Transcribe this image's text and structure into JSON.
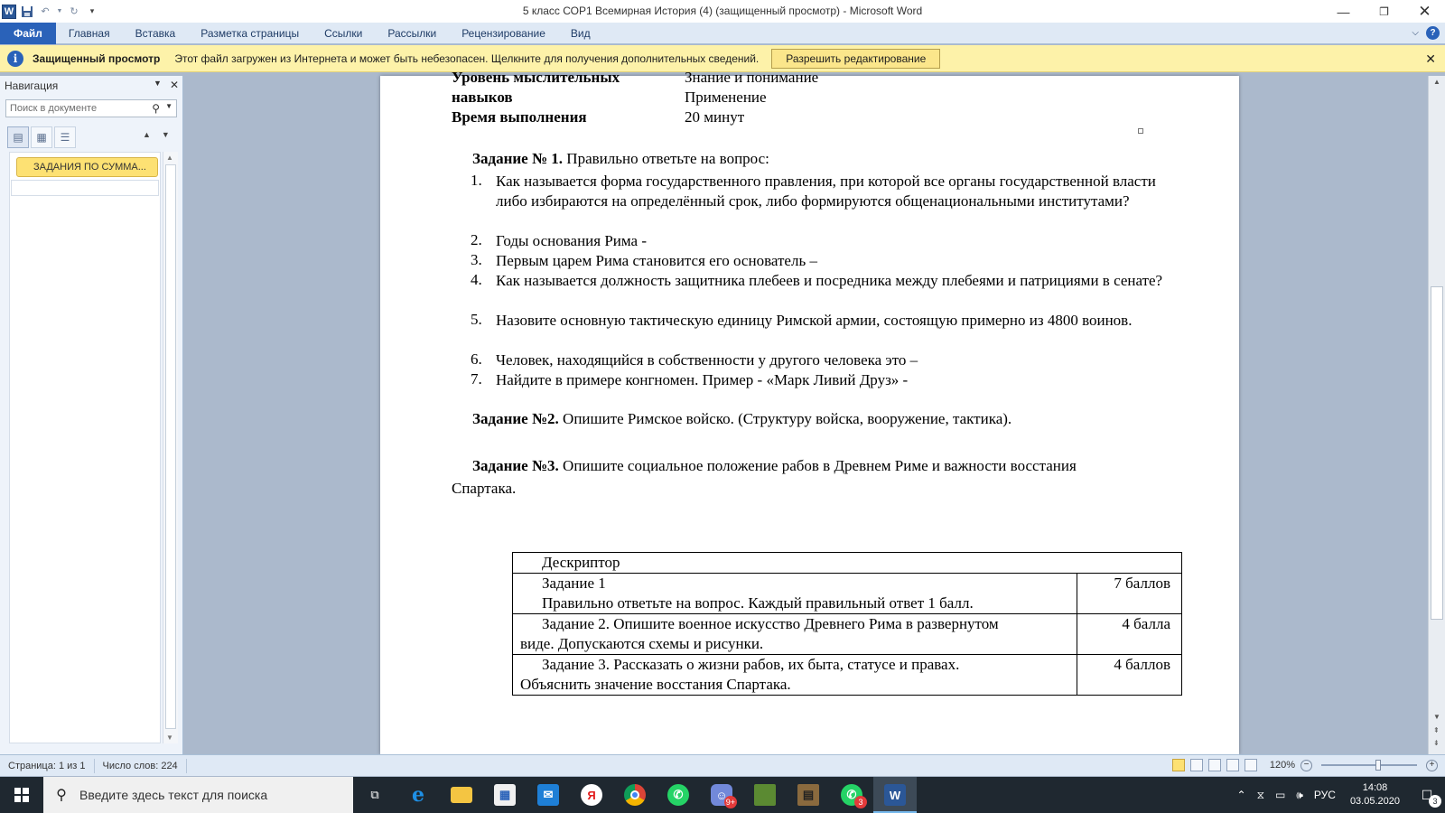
{
  "window": {
    "title": "5 класс СОР1 Всемирная История (4) (защищенный просмотр)  -  Microsoft Word",
    "logo_letter": "W"
  },
  "ribbon": {
    "tabs": [
      "Файл",
      "Главная",
      "Вставка",
      "Разметка страницы",
      "Ссылки",
      "Рассылки",
      "Рецензирование",
      "Вид"
    ]
  },
  "protected_bar": {
    "title": "Защищенный просмотр",
    "message": "Этот файл загружен из Интернета и может быть небезопасен. Щелкните для получения дополнительных сведений.",
    "button": "Разрешить редактирование"
  },
  "navigation": {
    "title": "Навигация",
    "search_placeholder": "Поиск в документе",
    "heading_item": "ЗАДАНИЯ ПО СУММА..."
  },
  "document": {
    "skill_label_1": "Уровень мыслительных",
    "skill_label_2": "навыков",
    "skill_value_1": "Знание и понимание",
    "skill_value_2": "Применение",
    "time_label": "Время выполнения",
    "time_value": "20 минут",
    "task1": {
      "label": "Задание № 1.",
      "text": " Правильно ответьте на вопрос:",
      "questions": [
        {
          "num": "1.",
          "text": "Как называется форма государственного правления, при которой все органы государственной власти либо избираются на определённый срок, либо формируются общенациональными институтами?"
        },
        {
          "num": "2.",
          "text": "Годы основания Рима  -"
        },
        {
          "num": "3.",
          "text": "Первым царем Рима становится его основатель –"
        },
        {
          "num": "4.",
          "text": "Как называется должность  защитника плебеев и посредника между плебеями и патрициями  в сенате?"
        },
        {
          "num": "5.",
          "text": "Назовите основную тактическую  единицу Римской армии, состоящую примерно из 4800 воинов."
        },
        {
          "num": "6.",
          "text": "Человек, находящийся в собственности  у другого человека это –"
        },
        {
          "num": "7.",
          "text": "Найдите в примере конгномен. Пример -  «Марк Ливий Друз» -"
        }
      ]
    },
    "task2": {
      "label": "Задание №2.",
      "text": "  Опишите  Римское войско.  (Структуру войска, вооружение, тактика)."
    },
    "task3": {
      "label": "Задание №3.",
      "text": "  Опишите социальное положение рабов в Древнем Риме и важности восстания",
      "text_cont": "Спартака."
    },
    "table": {
      "header": "Дескриптор",
      "rows": [
        {
          "line1": "Задание 1",
          "line2": "Правильно ответьте на вопрос. Каждый правильный ответ 1 балл.",
          "points": "7 баллов"
        },
        {
          "line1": "Задание 2.   Опишите военное искусство Древнего Рима в развернутом",
          "line2": "виде. Допускаются  схемы и рисунки.",
          "points": "4 балла"
        },
        {
          "line1": "Задание 3.  Рассказать  о жизни рабов, их быта, статусе  и правах.",
          "line2": "Объяснить значение восстания Спартака.",
          "points": "4 баллов"
        }
      ]
    }
  },
  "statusbar": {
    "page": "Страница: 1 из 1",
    "words": "Число слов: 224",
    "zoom": "120%"
  },
  "taskbar": {
    "search_placeholder": "Введите здесь текст для поиска",
    "discord_badge": "9+",
    "whatsapp_badge": "3",
    "lang": "РУС",
    "time": "14:08",
    "date": "03.05.2020",
    "notif_count": "3"
  }
}
